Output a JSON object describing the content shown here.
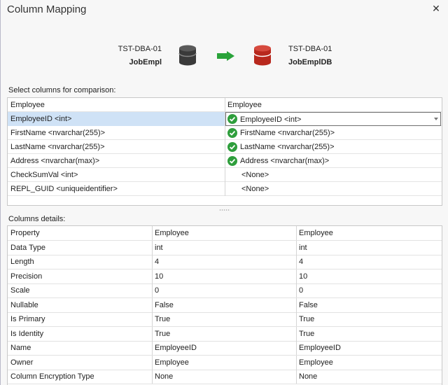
{
  "window": {
    "title": "Column Mapping",
    "close_glyph": "✕"
  },
  "source": {
    "server": "TST-DBA-01",
    "database": "JobEmpl",
    "icon": "database-icon",
    "icon_color": "#3a3a3a"
  },
  "target": {
    "server": "TST-DBA-01",
    "database": "JobEmplDB",
    "icon": "database-icon",
    "icon_color": "#b8281d"
  },
  "arrow": {
    "icon": "arrow-right-icon",
    "color": "#2aa33a"
  },
  "mapping": {
    "label": "Select columns for comparison:",
    "headers": [
      "Employee",
      "Employee"
    ],
    "rows": [
      {
        "source": "EmployeeID <int>",
        "target": "EmployeeID <int>",
        "matched": true,
        "selected": true
      },
      {
        "source": "FirstName <nvarchar(255)>",
        "target": "FirstName <nvarchar(255)>",
        "matched": true
      },
      {
        "source": "LastName <nvarchar(255)>",
        "target": "LastName <nvarchar(255)>",
        "matched": true
      },
      {
        "source": "Address <nvarchar(max)>",
        "target": "Address <nvarchar(max)>",
        "matched": true
      },
      {
        "source": "CheckSumVal <int>",
        "target": "<None>",
        "matched": false
      },
      {
        "source": "REPL_GUID <uniqueidentifier>",
        "target": "<None>",
        "matched": false
      }
    ],
    "check_color": "#2e9e3c",
    "selected_color": "#cfe2f6"
  },
  "details": {
    "label": "Columns details:",
    "headers": [
      "Property",
      "Employee",
      "Employee"
    ],
    "rows": [
      [
        "Data Type",
        "int",
        "int"
      ],
      [
        "Length",
        "4",
        "4"
      ],
      [
        "Precision",
        "10",
        "10"
      ],
      [
        "Scale",
        "0",
        "0"
      ],
      [
        "Nullable",
        "False",
        "False"
      ],
      [
        "Is Primary",
        "True",
        "True"
      ],
      [
        "Is Identity",
        "True",
        "True"
      ],
      [
        "Name",
        "EmployeeID",
        "EmployeeID"
      ],
      [
        "Owner",
        "Employee",
        "Employee"
      ],
      [
        "Column Encryption Type",
        "None",
        "None"
      ]
    ]
  }
}
